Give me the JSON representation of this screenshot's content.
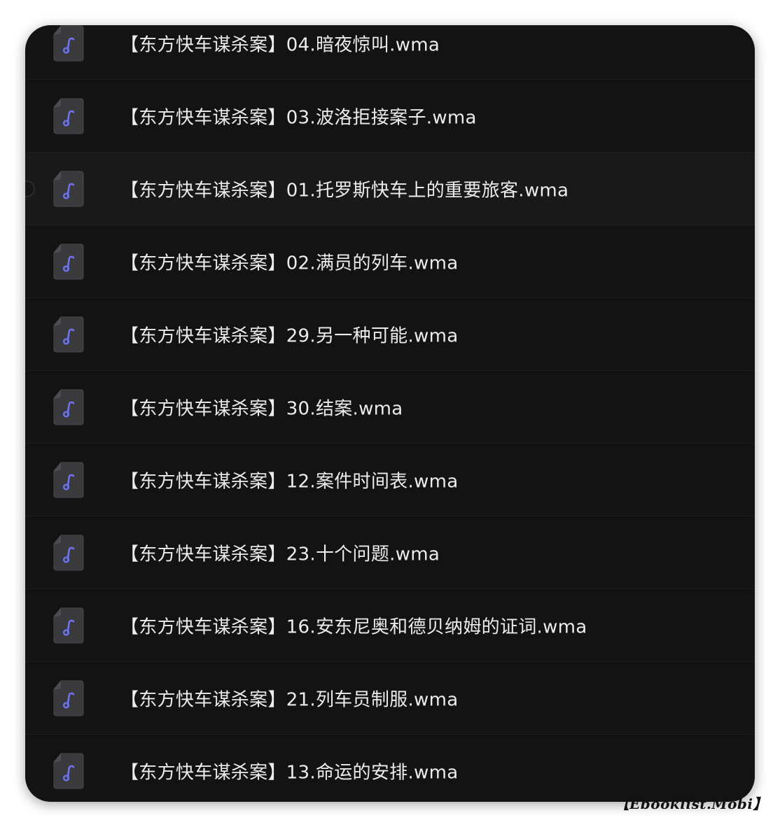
{
  "files": [
    {
      "name": "【东方快车谋杀案】04.暗夜惊叫.wma",
      "icon": "music-file-icon",
      "highlighted": false
    },
    {
      "name": "【东方快车谋杀案】03.波洛拒接案子.wma",
      "icon": "music-file-icon",
      "highlighted": false
    },
    {
      "name": "【东方快车谋杀案】01.托罗斯快车上的重要旅客.wma",
      "icon": "music-file-icon",
      "highlighted": true
    },
    {
      "name": "【东方快车谋杀案】02.满员的列车.wma",
      "icon": "music-file-icon",
      "highlighted": false
    },
    {
      "name": "【东方快车谋杀案】29.另一种可能.wma",
      "icon": "music-file-icon",
      "highlighted": false
    },
    {
      "name": "【东方快车谋杀案】30.结案.wma",
      "icon": "music-file-icon",
      "highlighted": false
    },
    {
      "name": "【东方快车谋杀案】12.案件时间表.wma",
      "icon": "music-file-icon",
      "highlighted": false
    },
    {
      "name": "【东方快车谋杀案】23.十个问题.wma",
      "icon": "music-file-icon",
      "highlighted": false
    },
    {
      "name": "【东方快车谋杀案】16.安东尼奥和德贝纳姆的证词.wma",
      "icon": "music-file-icon",
      "highlighted": false
    },
    {
      "name": "【东方快车谋杀案】21.列车员制服.wma",
      "icon": "music-file-icon",
      "highlighted": false
    },
    {
      "name": "【东方快车谋杀案】13.命运的安排.wma",
      "icon": "music-file-icon",
      "highlighted": false
    }
  ],
  "watermark": "【Ebooklist.Mobi】",
  "colors": {
    "background": "#131314",
    "row_highlight": "#19191a",
    "icon_body": "#3a3a3d",
    "icon_note": "#6f73f0",
    "text": "#ececef"
  }
}
